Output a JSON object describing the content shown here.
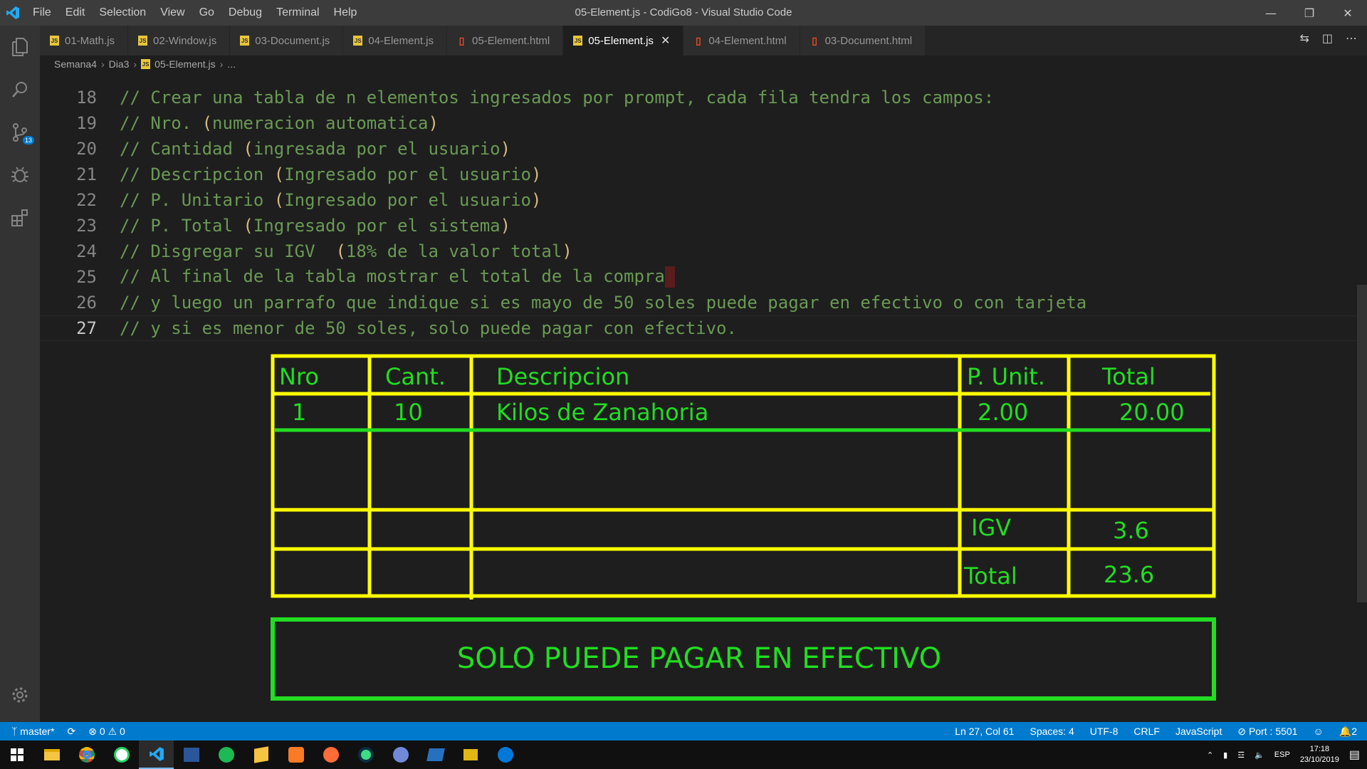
{
  "window": {
    "title": "05-Element.js - CodiGo8 - Visual Studio Code",
    "menu": [
      "File",
      "Edit",
      "Selection",
      "View",
      "Go",
      "Debug",
      "Terminal",
      "Help"
    ]
  },
  "activity": {
    "scm_badge": "13"
  },
  "tabs": [
    {
      "label": "01-Math.js",
      "type": "js"
    },
    {
      "label": "02-Window.js",
      "type": "js"
    },
    {
      "label": "03-Document.js",
      "type": "js"
    },
    {
      "label": "04-Element.js",
      "type": "js"
    },
    {
      "label": "05-Element.html",
      "type": "html"
    },
    {
      "label": "05-Element.js",
      "type": "js",
      "active": true
    },
    {
      "label": "04-Element.html",
      "type": "html"
    },
    {
      "label": "03-Document.html",
      "type": "html"
    }
  ],
  "breadcrumb": [
    "Semana4",
    "Dia3",
    "05-Element.js",
    "..."
  ],
  "editor": {
    "lines": [
      {
        "num": "18",
        "text": "// Crear una tabla de n elementos ingresados por prompt, cada fila tendra los campos:"
      },
      {
        "num": "19",
        "pre": "// Nro. ",
        "paren": "(",
        "mid": "numeracion automatica",
        "close": ")"
      },
      {
        "num": "20",
        "pre": "// Cantidad ",
        "paren": "(",
        "mid": "ingresada por el usuario",
        "close": ")"
      },
      {
        "num": "21",
        "pre": "// Descripcion ",
        "paren": "(",
        "mid": "Ingresado por el usuario",
        "close": ")"
      },
      {
        "num": "22",
        "pre": "// P. Unitario ",
        "paren": "(",
        "mid": "Ingresado por el usuario",
        "close": ")"
      },
      {
        "num": "23",
        "pre": "// P. Total ",
        "paren": "(",
        "mid": "Ingresado por el sistema",
        "close": ")"
      },
      {
        "num": "24",
        "pre": "// Disgregar su IGV  ",
        "paren": "(",
        "mid": "18% de la valor total",
        "close": ")"
      },
      {
        "num": "25",
        "text": "// Al final de la tabla mostrar el total de la compra"
      },
      {
        "num": "26",
        "text": "// y luego un parrafo que indique si es mayo de 50 soles puede pagar en efectivo o con tarjeta"
      },
      {
        "num": "27",
        "text": "// y si es menor de 50 soles, solo puede pagar con efectivo."
      }
    ]
  },
  "drawing": {
    "headers": [
      "Nro",
      "Cant.",
      "Descripcion",
      "P. Unit.",
      "Total"
    ],
    "row": [
      "1",
      "10",
      "Kilos de Zanahoria",
      "2.00",
      "20.00"
    ],
    "igv_label": "IGV",
    "igv_value": "3.6",
    "total_label": "Total",
    "total_value": "23.6",
    "message": "SOLO PUEDE PAGAR EN EFECTIVO",
    "table_color": "#ffff00",
    "ink_color": "#22dd22"
  },
  "status": {
    "branch": "master*",
    "errors": "0",
    "warnings": "0",
    "position": "Ln 27, Col 61",
    "spaces": "Spaces: 4",
    "encoding": "UTF-8",
    "eol": "CRLF",
    "language": "JavaScript",
    "port": "Port : 5501",
    "notifications": "2"
  },
  "taskbar": {
    "lang": "ESP",
    "time": "17:18",
    "date": "23/10/2019"
  },
  "colors": {
    "accent": "#007acc",
    "comment": "#6a9955",
    "paren": "#d7ba7d"
  }
}
